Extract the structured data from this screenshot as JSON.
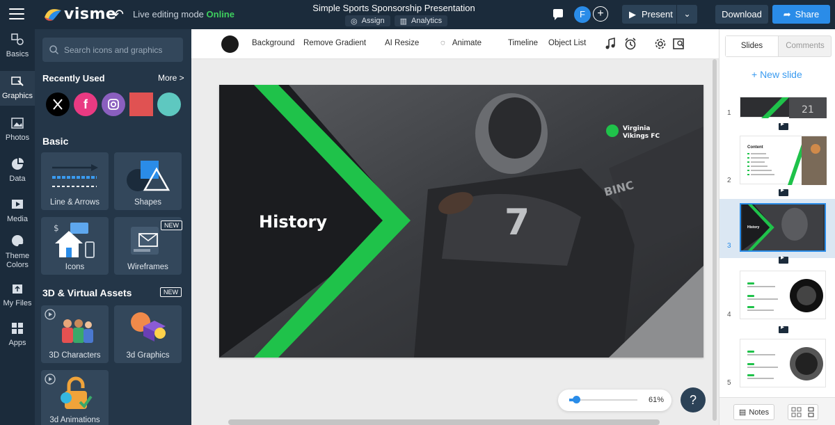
{
  "header": {
    "logo_text": "visme",
    "live_mode_label": "Live editing mode",
    "live_mode_status": "Online",
    "doc_title": "Simple Sports Sponsorship Presentation",
    "assign_label": "Assign",
    "analytics_label": "Analytics",
    "avatar_initial": "F",
    "present_label": "Present",
    "download_label": "Download",
    "share_label": "Share"
  },
  "rail": {
    "items": [
      {
        "label": "Basics",
        "icon": "shapes-icon"
      },
      {
        "label": "Graphics",
        "icon": "graphics-icon"
      },
      {
        "label": "Photos",
        "icon": "image-icon"
      },
      {
        "label": "Data",
        "icon": "pie-chart-icon"
      },
      {
        "label": "Media",
        "icon": "video-icon"
      },
      {
        "label": "Theme",
        "label2": "Colors",
        "icon": "palette-icon"
      },
      {
        "label": "My Files",
        "icon": "upload-icon"
      },
      {
        "label": "Apps",
        "icon": "apps-grid-icon"
      }
    ]
  },
  "panel": {
    "search_placeholder": "Search icons and graphics",
    "recently_used_title": "Recently Used",
    "more_label": "More >",
    "recent_items": [
      "x-logo",
      "facebook-logo",
      "instagram-logo",
      "red-square",
      "teal-circle"
    ],
    "basic_title": "Basic",
    "tiles": [
      {
        "label": "Line & Arrows"
      },
      {
        "label": "Shapes"
      },
      {
        "label": "Icons"
      },
      {
        "label": "Wireframes",
        "badge": "NEW"
      }
    ],
    "assets_title": "3D & Virtual Assets",
    "assets_badge": "NEW",
    "asset_tiles": [
      {
        "label": "3D Characters"
      },
      {
        "label": "3d Graphics"
      },
      {
        "label": "3d Animations"
      }
    ]
  },
  "toolbar": {
    "background_label": "Background",
    "remove_gradient_label": "Remove Gradient",
    "ai_resize_label": "AI Resize",
    "animate_label": "Animate",
    "timeline_label": "Timeline",
    "object_list_label": "Object List"
  },
  "slide": {
    "title": "History",
    "brand_line1": "Virginia",
    "brand_line2": "Vikings FC",
    "accent_color": "#1fc24a"
  },
  "zoom": {
    "value": "61%",
    "level": 0.1
  },
  "help_label": "?",
  "rpanel": {
    "tab_slides": "Slides",
    "tab_comments": "Comments",
    "new_slide_label": "+ New slide",
    "thumbs": [
      {
        "num": "1"
      },
      {
        "num": "2",
        "heading": "Content"
      },
      {
        "num": "3",
        "heading": "History",
        "selected": true
      },
      {
        "num": "4"
      },
      {
        "num": "5"
      }
    ],
    "notes_label": "Notes"
  },
  "colors": {
    "sidebar": "#1b2b3b",
    "panel": "#243648",
    "primary": "#2a8ce8",
    "online": "#3ecf5e"
  }
}
